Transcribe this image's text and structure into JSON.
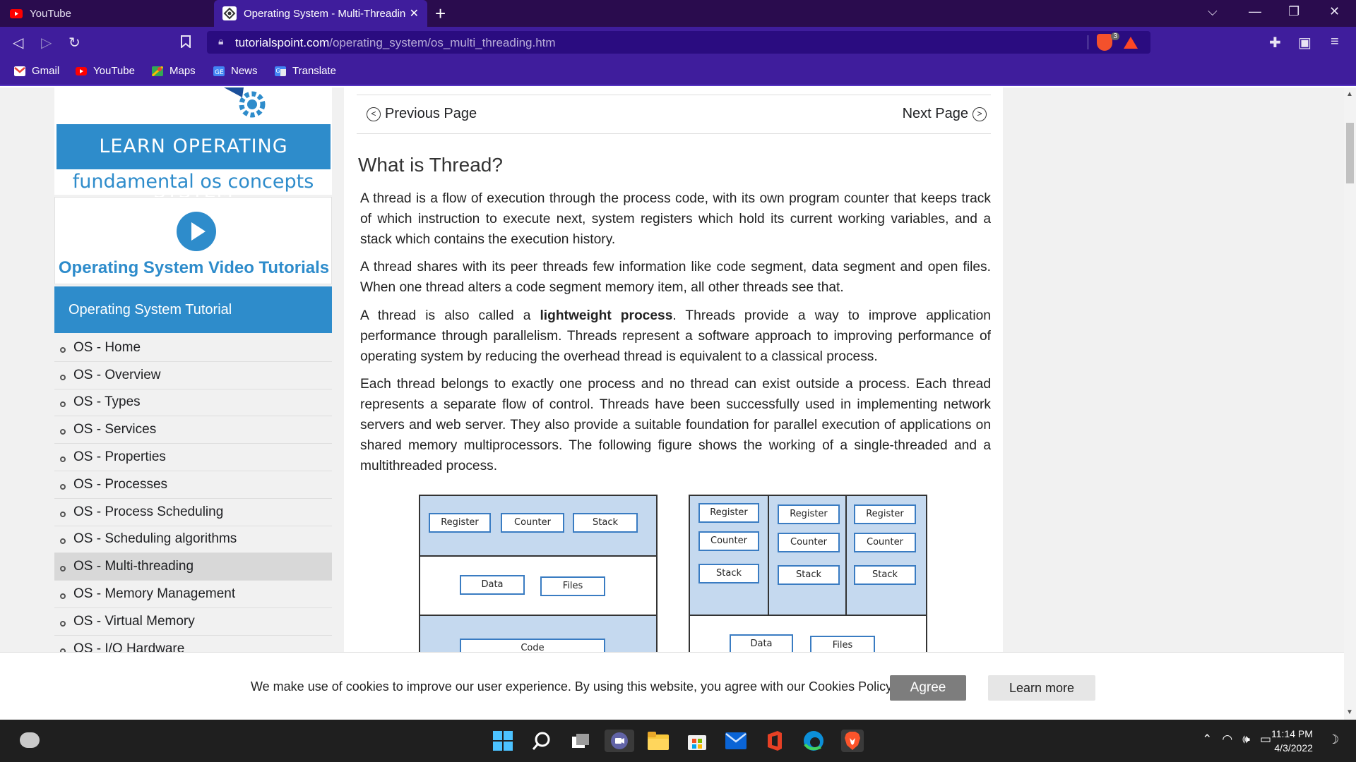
{
  "browser": {
    "tabs": [
      {
        "title": "YouTube",
        "active": false
      },
      {
        "title": "Operating System - Multi-Threading",
        "active": true
      }
    ],
    "address": {
      "domain": "tutorialspoint.com",
      "path": "/operating_system/os_multi_threading.htm"
    },
    "shield_count": "3",
    "bookmarks": [
      "Gmail",
      "YouTube",
      "Maps",
      "News",
      "Translate"
    ],
    "colors": {
      "chrome_dark": "#2a0c4e",
      "chrome": "#3f1d9c",
      "accent": "#2e8ccb"
    }
  },
  "sidebar": {
    "banner_title": "LEARN OPERATING SYSTEM",
    "banner_subtitle": "fundamental os concepts",
    "video_title": "Operating System Video Tutorials",
    "heading": "Operating System Tutorial",
    "items": [
      {
        "label": "OS - Home",
        "active": false
      },
      {
        "label": "OS - Overview",
        "active": false
      },
      {
        "label": "OS - Types",
        "active": false
      },
      {
        "label": "OS - Services",
        "active": false
      },
      {
        "label": "OS - Properties",
        "active": false
      },
      {
        "label": "OS - Processes",
        "active": false
      },
      {
        "label": "OS - Process Scheduling",
        "active": false
      },
      {
        "label": "OS - Scheduling algorithms",
        "active": false
      },
      {
        "label": "OS - Multi-threading",
        "active": true
      },
      {
        "label": "OS - Memory Management",
        "active": false
      },
      {
        "label": "OS - Virtual Memory",
        "active": false
      },
      {
        "label": "OS - I/O Hardware",
        "active": false
      }
    ]
  },
  "content": {
    "prev_label": "Previous Page",
    "next_label": "Next Page",
    "title": "What is Thread?",
    "p1": "A thread is a flow of execution through the process code, with its own program counter that keeps track of which instruction to execute next, system registers which hold its current working variables, and a stack which contains the execution history.",
    "p2": "A thread shares with its peer threads few information like code segment, data segment and open files. When one thread alters a code segment memory item, all other threads see that.",
    "p3_before": "A thread is also called a ",
    "p3_bold": "lightweight process",
    "p3_after": ". Threads provide a way to improve application performance through parallelism. Threads represent a software approach to improving performance of operating system by reducing the overhead thread is equivalent to a classical process.",
    "p4": "Each thread belongs to exactly one process and no thread can exist outside a process. Each thread represents a separate flow of control. Threads have been successfully used in implementing network servers and web server. They also provide a suitable foundation for parallel execution of applications on shared memory multiprocessors. The following figure shows the working of a single-threaded and a multithreaded process.",
    "figure": {
      "register": "Register",
      "counter": "Counter",
      "stack": "Stack",
      "data": "Data",
      "files": "Files",
      "code": "Code"
    }
  },
  "cookie": {
    "text": "We make use of cookies to improve our user experience. By using this website, you agree with our Cookies Policy.",
    "agree": "Agree",
    "learn_more": "Learn more"
  },
  "taskbar": {
    "time": "11:14 PM",
    "date": "4/3/2022"
  }
}
